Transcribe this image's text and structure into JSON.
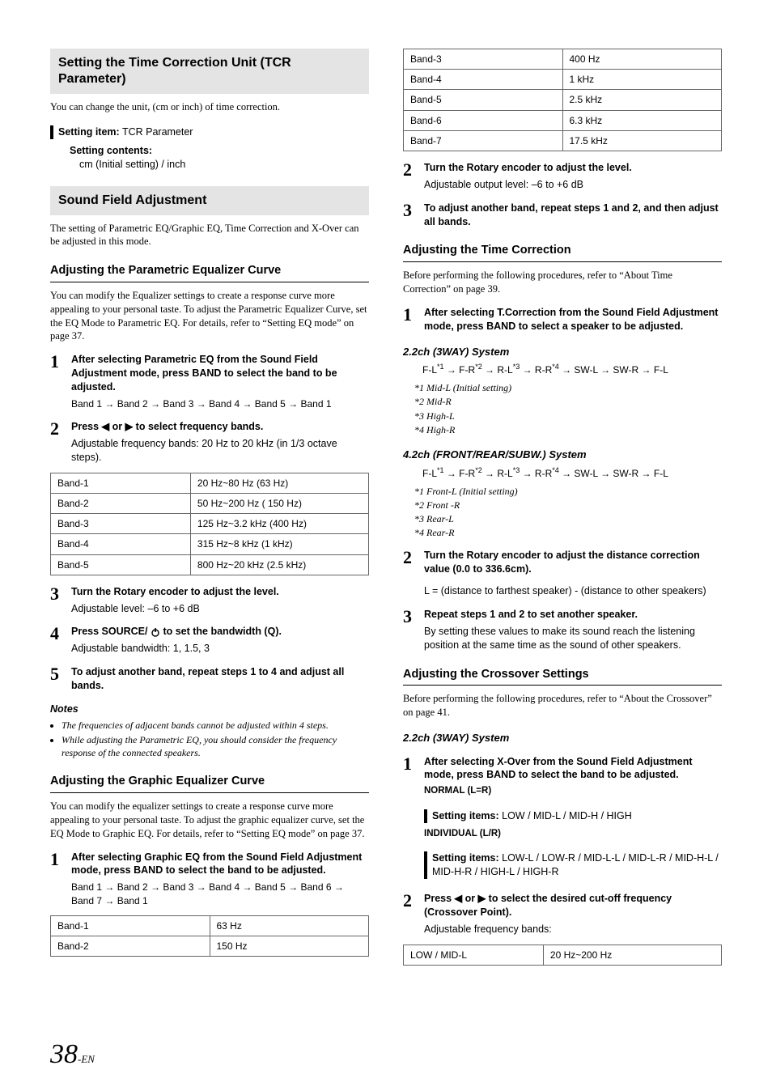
{
  "left": {
    "tcr": {
      "heading": "Setting the Time Correction Unit (TCR Parameter)",
      "intro": "You can change the unit, (cm or inch) of time correction.",
      "setting_item_label": "Setting item:",
      "setting_item_value": " TCR Parameter",
      "setting_contents_label": "Setting contents:",
      "setting_contents_value": "cm (Initial setting) / inch"
    },
    "sfa": {
      "heading": "Sound Field Adjustment",
      "intro": "The setting of Parametric EQ/Graphic EQ, Time Correction and X-Over can be adjusted in this mode."
    },
    "peq": {
      "heading": "Adjusting the Parametric Equalizer Curve",
      "intro": "You can modify the Equalizer settings to create a response curve more appealing to your personal taste. To adjust the Parametric Equalizer Curve, set the EQ Mode to Parametric EQ. For details, refer to “Setting EQ mode” on page 37.",
      "step1": "After selecting Parametric EQ from the Sound Field Adjustment mode, press BAND to select the band to be adjusted.",
      "seq1": "Band 1 → Band 2 → Band 3 → Band 4 → Band 5 → Band 1",
      "step2_lead_a": "Press ",
      "step2_lead_b": " to select frequency bands.",
      "step2_follow": "Adjustable frequency bands: 20 Hz to 20 kHz (in 1/3 octave steps).",
      "table": [
        [
          "Band-1",
          "20 Hz~80 Hz (63 Hz)"
        ],
        [
          "Band-2",
          "50 Hz~200 Hz ( 150 Hz)"
        ],
        [
          "Band-3",
          "125 Hz~3.2 kHz (400 Hz)"
        ],
        [
          "Band-4",
          "315 Hz~8 kHz (1 kHz)"
        ],
        [
          "Band-5",
          "800 Hz~20 kHz (2.5 kHz)"
        ]
      ],
      "step3_lead": "Turn the Rotary encoder to adjust the level.",
      "step3_follow": "Adjustable level: –6 to +6 dB",
      "step4_lead_a": "Press SOURCE/ ",
      "step4_lead_b": " to set the bandwidth (Q).",
      "step4_follow": "Adjustable bandwidth: 1, 1.5, 3",
      "step5": "To adjust another band, repeat steps 1 to 4 and adjust all bands.",
      "notes_h": "Notes",
      "note1": "The frequencies of adjacent bands cannot be adjusted within 4 steps.",
      "note2": "While adjusting the Parametric EQ, you should consider the frequency response of the connected speakers."
    },
    "geq": {
      "heading": "Adjusting the Graphic Equalizer Curve",
      "intro": "You can modify the equalizer settings to create a response curve more appealing to your personal taste. To adjust the graphic equalizer curve, set the EQ Mode to Graphic EQ. For details, refer to “Setting EQ mode” on page 37.",
      "step1": "After selecting Graphic EQ from the Sound Field Adjustment mode, press BAND to select the band to be adjusted.",
      "seq1a": "Band 1 → Band 2 → Band 3 → Band 4 → Band 5 → Band 6 → Band 7 → Band 1",
      "table": [
        [
          "Band-1",
          "63 Hz"
        ],
        [
          "Band-2",
          "150 Hz"
        ]
      ]
    }
  },
  "right": {
    "geq_table_cont": [
      [
        "Band-3",
        "400 Hz"
      ],
      [
        "Band-4",
        "1 kHz"
      ],
      [
        "Band-5",
        "2.5 kHz"
      ],
      [
        "Band-6",
        "6.3 kHz"
      ],
      [
        "Band-7",
        "17.5 kHz"
      ]
    ],
    "geq_step2_lead": "Turn the Rotary encoder to adjust the level.",
    "geq_step2_follow": "Adjustable output level: –6 to +6 dB",
    "geq_step3": "To adjust another band, repeat steps 1 and 2, and then adjust all bands.",
    "tc": {
      "heading": "Adjusting the Time Correction",
      "intro": "Before performing the following procedures, refer to “About Time Correction” on page 39.",
      "step1": "After selecting T.Correction from the Sound Field Adjustment mode, press BAND to select a speaker to be adjusted.",
      "sys_a_h": "2.2ch (3WAY) System",
      "seq_a_parts": [
        "F-L",
        "*1",
        "→",
        "F-R",
        "*2",
        "→",
        "R-L",
        "*3",
        "→",
        "R-R",
        "*4",
        "→",
        "SW-L",
        "→",
        "SW-R",
        "→",
        "F-L"
      ],
      "fn_a": [
        "*1   Mid-L (Initial setting)",
        "*2   Mid-R",
        "*3   High-L",
        "*4   High-R"
      ],
      "sys_b_h": "4.2ch (FRONT/REAR/SUBW.) System",
      "fn_b": [
        "*1   Front-L (Initial setting)",
        "*2   Front -R",
        "*3   Rear-L",
        "*4   Rear-R"
      ],
      "step2_lead": "Turn the Rotary encoder to adjust the distance correction value (0.0 to 336.6cm).",
      "step2_follow": "L = (distance to farthest speaker) - (distance to other speakers)",
      "step3_lead": "Repeat steps 1 and 2 to set another speaker.",
      "step3_follow": "By setting these values to make its sound reach the listening position at the same time as the sound of other speakers."
    },
    "xo": {
      "heading": "Adjusting the Crossover Settings",
      "intro": "Before performing the following procedures, refer to “About the Crossover” on page 41.",
      "sys_a_h": "2.2ch (3WAY) System",
      "step1_lead": "After selecting X-Over from the Sound Field Adjustment mode, press BAND to select the band to be adjusted.",
      "normal_h": "NORMAL (L=R)",
      "si_label": "Setting items:  ",
      "si_normal": "LOW / MID-L / MID-H / HIGH",
      "indiv_h": "INDIVIDUAL (L/R)",
      "si_indiv": "LOW-L / LOW-R / MID-L-L / MID-L-R / MID-H-L / MID-H-R / HIGH-L / HIGH-R",
      "step2_lead_a": "Press ",
      "step2_lead_b": " to select the desired cut-off frequency (Crossover Point).",
      "step2_follow": "Adjustable frequency bands:",
      "table": [
        [
          "LOW / MID-L",
          "20 Hz~200 Hz"
        ]
      ]
    }
  },
  "page": {
    "num": "38",
    "suffix": "-EN"
  },
  "left_right_tri": "◀ or ▶"
}
